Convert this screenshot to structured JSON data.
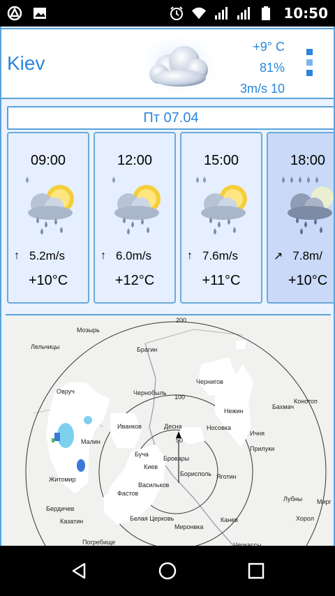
{
  "status": {
    "time": "10:50"
  },
  "current": {
    "city": "Kiev",
    "temp": "+9° C",
    "humidity": "81%",
    "wind": "3m/s 10"
  },
  "date": {
    "label": "Пт 07.04"
  },
  "forecast": [
    {
      "time": "09:00",
      "wind": "5.2m/s",
      "temp": "+10°C"
    },
    {
      "time": "12:00",
      "wind": "6.0m/s",
      "temp": "+12°C"
    },
    {
      "time": "15:00",
      "wind": "7.6m/s",
      "temp": "+11°C"
    },
    {
      "time": "18:00",
      "wind": "7.8m/",
      "temp": "+10°C"
    }
  ],
  "map": {
    "ring_labels": [
      "200",
      "100",
      "50"
    ],
    "places": [
      "Мозырь",
      "Лельчицы",
      "Брагин",
      "Овруч",
      "Чернобыль",
      "Чернигов",
      "Нежин",
      "Бахмач",
      "Конотоп",
      "Иванков",
      "Малин",
      "Десна",
      "Носовка",
      "Ичня",
      "Прилуки",
      "Буча",
      "Бровары",
      "Киев",
      "Житомир",
      "Борисполь",
      "Яготин",
      "Васильков",
      "Фастов",
      "Бердичев",
      "Белая Церковь",
      "Миронвка",
      "Канев",
      "Лубны",
      "Миргс",
      "Хорол",
      "Казатин",
      "Погребище",
      "Черкассы"
    ]
  },
  "colors": {
    "accent": "#2a86dc",
    "border": "#59a2dc",
    "bg": "#eaf3ff"
  }
}
